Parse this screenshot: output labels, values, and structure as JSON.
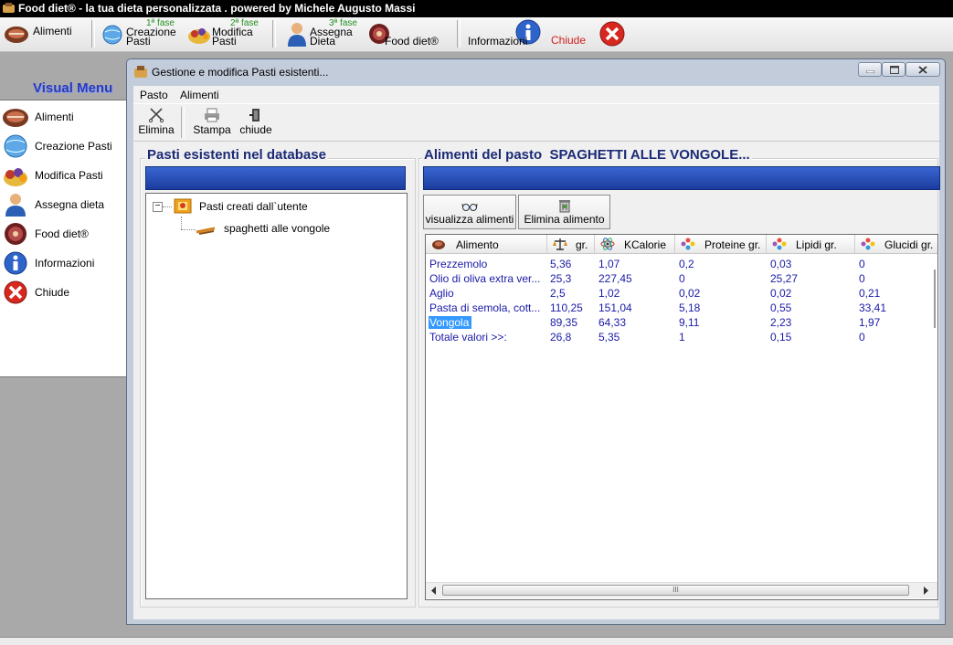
{
  "app": {
    "title": "Food diet® - la tua dieta personalizzata . powered by Michele Augusto Massi"
  },
  "main_toolbar": {
    "alimenti": "Alimenti",
    "creazione_phase": "1ª fase",
    "creazione_l1": "Creazione",
    "creazione_l2": "Pasti",
    "modifica_phase": "2ª fase",
    "modifica_l1": "Modifica",
    "modifica_l2": "Pasti",
    "assegna_phase": "3ª fase",
    "assegna_l1": "Assegna",
    "assegna_l2": "Dieta",
    "fooddiet": "Food diet®",
    "informazioni": "Informazioni",
    "chiude": "Chiude"
  },
  "visual_menu": {
    "title": "Visual Menu",
    "items": [
      {
        "label": "Alimenti",
        "icon": "meat-icon"
      },
      {
        "label": "Creazione Pasti",
        "icon": "globe-icon"
      },
      {
        "label": "Modifica Pasti",
        "icon": "food-icon"
      },
      {
        "label": "Assegna dieta",
        "icon": "user-icon"
      },
      {
        "label": "Food diet®",
        "icon": "plate-icon"
      },
      {
        "label": "Informazioni",
        "icon": "info-icon"
      },
      {
        "label": "Chiude",
        "icon": "close-icon"
      }
    ]
  },
  "dialog": {
    "title": "Gestione e modifica Pasti esistenti...",
    "menu": [
      "Pasto",
      "Alimenti"
    ],
    "toolbar": {
      "elimina": "Elimina",
      "stampa": "Stampa",
      "chiude": "chiude"
    },
    "left_group": {
      "title": "Pasti esistenti nel database",
      "tree_root": "Pasti creati dall`utente",
      "tree_child": "spaghetti alle vongole",
      "expander": "−"
    },
    "right_group": {
      "title": "Alimenti del pasto  SPAGHETTI ALLE VONGOLE...",
      "btn_view": "visualizza alimenti",
      "btn_delete": "Elimina alimento"
    },
    "table": {
      "columns": [
        "Alimento",
        "gr.",
        "KCalorie",
        "Proteine gr.",
        "Lipidi gr.",
        "Glucidi gr."
      ],
      "rows": [
        [
          "Prezzemolo",
          "5,36",
          "1,07",
          "0,2",
          "0,03",
          "0"
        ],
        [
          "Olio di oliva extra ver...",
          "25,3",
          "227,45",
          "0",
          "25,27",
          "0"
        ],
        [
          "Aglio",
          "2,5",
          "1,02",
          "0,02",
          "0,02",
          "0,21"
        ],
        [
          "Pasta di semola, cott...",
          "110,25",
          "151,04",
          "5,18",
          "0,55",
          "33,41"
        ],
        [
          "Vongola",
          "89,35",
          "64,33",
          "9,11",
          "2,23",
          "1,97"
        ],
        [
          "Totale valori >>:",
          "26,8",
          "5,35",
          "1",
          "0,15",
          "0"
        ]
      ],
      "selected_row": 4
    },
    "scroll_grip": "III"
  },
  "colors": {
    "blue_bar": "#1b3c9e",
    "table_text": "#1a1aa8",
    "selection": "#3399ff",
    "chiude_red": "#d11c1c",
    "visual_menu_title": "#2a3bb3"
  }
}
